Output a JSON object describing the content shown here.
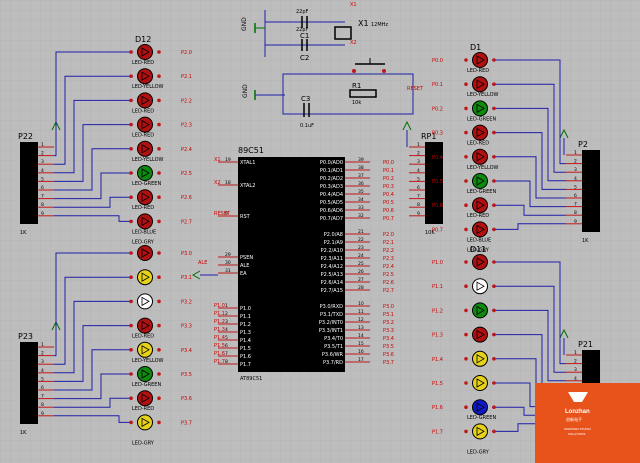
{
  "colors": {
    "background": "#bdbdbd",
    "grid": "#aeaeae",
    "wire": "#1f1fa8",
    "pin": "#c01818",
    "chip": "#000000",
    "label_text": "#000000",
    "net_label": "#cc0000",
    "ground": "#007000",
    "led_red": "#b01010",
    "led_green": "#0d8a0d",
    "led_yellow": "#e6d21a",
    "led_blue": "#1018c8",
    "led_white": "#ffffff",
    "logo_bg": "#e8531b"
  },
  "chip": {
    "name": "89C51",
    "part": "AT89C51",
    "left_pins": [
      {
        "num": "19",
        "name": "XTAL1"
      },
      {
        "num": "18",
        "name": "XTAL2"
      },
      {
        "num": "9",
        "name": "RST"
      },
      {
        "num": "29",
        "name": "PSEN"
      },
      {
        "num": "30",
        "name": "ALE"
      },
      {
        "num": "31",
        "name": "EA"
      },
      {
        "num": "1",
        "name": "P1.0"
      },
      {
        "num": "2",
        "name": "P1.1"
      },
      {
        "num": "3",
        "name": "P1.2"
      },
      {
        "num": "4",
        "name": "P1.3"
      },
      {
        "num": "5",
        "name": "P1.4"
      },
      {
        "num": "6",
        "name": "P1.5"
      },
      {
        "num": "7",
        "name": "P1.6"
      },
      {
        "num": "8",
        "name": "P1.7"
      }
    ],
    "left_net_labels": [
      "X1",
      "X2",
      "RESET",
      "ALE",
      "P1.0",
      "P1.1",
      "P1.2",
      "P1.3",
      "P1.4",
      "P1.5",
      "P1.6",
      "P1.7"
    ],
    "right_pins": [
      {
        "num": "39",
        "name": "P0.0/AD0"
      },
      {
        "num": "38",
        "name": "P0.1/AD1"
      },
      {
        "num": "37",
        "name": "P0.2/AD2"
      },
      {
        "num": "36",
        "name": "P0.3/AD3"
      },
      {
        "num": "35",
        "name": "P0.4/AD4"
      },
      {
        "num": "34",
        "name": "P0.5/AD5"
      },
      {
        "num": "33",
        "name": "P0.6/AD6"
      },
      {
        "num": "32",
        "name": "P0.7/AD7"
      },
      {
        "num": "21",
        "name": "P2.0/A8"
      },
      {
        "num": "22",
        "name": "P2.1/A9"
      },
      {
        "num": "23",
        "name": "P2.2/A10"
      },
      {
        "num": "24",
        "name": "P2.3/A11"
      },
      {
        "num": "25",
        "name": "P2.4/A12"
      },
      {
        "num": "26",
        "name": "P2.5/A13"
      },
      {
        "num": "27",
        "name": "P2.6/A14"
      },
      {
        "num": "28",
        "name": "P2.7/A15"
      },
      {
        "num": "10",
        "name": "P3.0/RXD"
      },
      {
        "num": "11",
        "name": "P3.1/TXD"
      },
      {
        "num": "12",
        "name": "P3.2/INT0"
      },
      {
        "num": "13",
        "name": "P3.3/INT1"
      },
      {
        "num": "14",
        "name": "P3.4/T0"
      },
      {
        "num": "15",
        "name": "P3.5/T1"
      },
      {
        "num": "16",
        "name": "P3.6/WR"
      },
      {
        "num": "17",
        "name": "P3.7/RD"
      }
    ],
    "right_net_labels": [
      "P0.0",
      "P0.1",
      "P0.2",
      "P0.3",
      "P0.4",
      "P0.5",
      "P0.6",
      "P0.7",
      "P2.0",
      "P2.1",
      "P2.2",
      "P2.3",
      "P2.4",
      "P2.5",
      "P2.6",
      "P2.7",
      "P3.0",
      "P3.1",
      "P3.2",
      "P3.3",
      "P3.4",
      "P3.5",
      "P3.6",
      "P3.7"
    ]
  },
  "crystal": {
    "ref": "X1",
    "value": "12MHz",
    "pin1": "X1",
    "pin2": "X2"
  },
  "caps": [
    {
      "ref": "C1",
      "value": "22pF"
    },
    {
      "ref": "C2",
      "value": "22pF"
    },
    {
      "ref": "C3",
      "value": "0.1uF"
    }
  ],
  "resistor": {
    "ref": "R1",
    "value": "10k"
  },
  "reset_label": "RESET",
  "gnd_label": "GND",
  "connectors": [
    {
      "ref": "P22",
      "value": "1K",
      "pins": [
        "1",
        "2",
        "3",
        "4",
        "5",
        "6",
        "7",
        "8",
        "9"
      ]
    },
    {
      "ref": "P23",
      "value": "1K",
      "pins": [
        "1",
        "2",
        "3",
        "4",
        "5",
        "6",
        "7",
        "8",
        "9"
      ]
    },
    {
      "ref": "RP1",
      "value": "10K",
      "pins": [
        "1",
        "2",
        "3",
        "4",
        "5",
        "6",
        "7",
        "8",
        "9"
      ]
    },
    {
      "ref": "P2",
      "value": "1K",
      "pins": [
        "1",
        "2",
        "3",
        "4",
        "5",
        "6",
        "7",
        "8",
        "9"
      ]
    },
    {
      "ref": "P21",
      "value": "1K",
      "pins": [
        "1",
        "2",
        "3",
        "4",
        "5",
        "6",
        "7",
        "8",
        "9"
      ]
    }
  ],
  "led_groups": [
    {
      "group": "P2-leds",
      "title": "D12",
      "leds": [
        {
          "color": "red",
          "label": "LED-RED",
          "net": "P2.0"
        },
        {
          "color": "red",
          "label": "LED-YELLOW",
          "net": "P2.1"
        },
        {
          "color": "red",
          "label": "LED-RED",
          "net": "P2.2"
        },
        {
          "color": "red",
          "label": "LED-RED",
          "net": "P2.3"
        },
        {
          "color": "red",
          "label": "LED-YELLOW",
          "net": "P2.4"
        },
        {
          "color": "green",
          "label": "LED-GREEN",
          "net": "P2.5"
        },
        {
          "color": "red",
          "label": "LED-RED",
          "net": "P2.6"
        },
        {
          "color": "red",
          "label": "LED-BLUE",
          "net": "P2.7"
        }
      ],
      "bottom_label": "LED-GRY"
    },
    {
      "group": "P3-leds",
      "title": "",
      "leds": [
        {
          "color": "red",
          "label": "",
          "net": "P3.0"
        },
        {
          "color": "yellow",
          "label": "",
          "net": "P3.1"
        },
        {
          "color": "white",
          "label": "",
          "net": "P3.2"
        },
        {
          "color": "red",
          "label": "LED-RED",
          "net": "P3.3"
        },
        {
          "color": "yellow",
          "label": "LED-YELLOW",
          "net": "P3.4"
        },
        {
          "color": "green",
          "label": "LED-GREEN",
          "net": "P3.5"
        },
        {
          "color": "red",
          "label": "LED-RED",
          "net": "P3.6"
        },
        {
          "color": "yellow",
          "label": "",
          "net": "P3.7"
        }
      ],
      "bottom_label": "LED-GRY"
    },
    {
      "group": "P0-leds",
      "title": "D1",
      "leds": [
        {
          "color": "red",
          "label": "LED-RED",
          "net": "P0.0"
        },
        {
          "color": "red",
          "label": "LED-YELLOW",
          "net": "P0.1"
        },
        {
          "color": "green",
          "label": "LED-GREEN",
          "net": "P0.2"
        },
        {
          "color": "red",
          "label": "LED-RED",
          "net": "P0.3"
        },
        {
          "color": "red",
          "label": "LED-YELLOW",
          "net": "P0.4"
        },
        {
          "color": "green",
          "label": "LED-GREEN",
          "net": "P0.5"
        },
        {
          "color": "red",
          "label": "LED-RED",
          "net": "P0.6"
        },
        {
          "color": "red",
          "label": "LED-BLUE",
          "net": "P0.7"
        }
      ],
      "bottom_label": "LED-GRY"
    },
    {
      "group": "P1-leds",
      "title": "D11",
      "leds": [
        {
          "color": "red",
          "label": "",
          "net": "P1.0"
        },
        {
          "color": "white",
          "label": "",
          "net": "P1.1"
        },
        {
          "color": "green",
          "label": "",
          "net": "P1.2"
        },
        {
          "color": "red",
          "label": "",
          "net": "P1.3"
        },
        {
          "color": "yellow",
          "label": "",
          "net": "P1.4"
        },
        {
          "color": "yellow",
          "label": "",
          "net": "P1.5"
        },
        {
          "color": "blue",
          "label": "LED-GREEN",
          "net": "P1.6"
        },
        {
          "color": "yellow",
          "label": "",
          "net": "P1.7"
        }
      ],
      "bottom_label": "LED-GRY"
    }
  ],
  "logo": {
    "brand": "Lonzhan",
    "sub": "创新电子",
    "tagline1": "SMARTER STUDIO",
    "tagline2": "SOLUTIONS"
  }
}
